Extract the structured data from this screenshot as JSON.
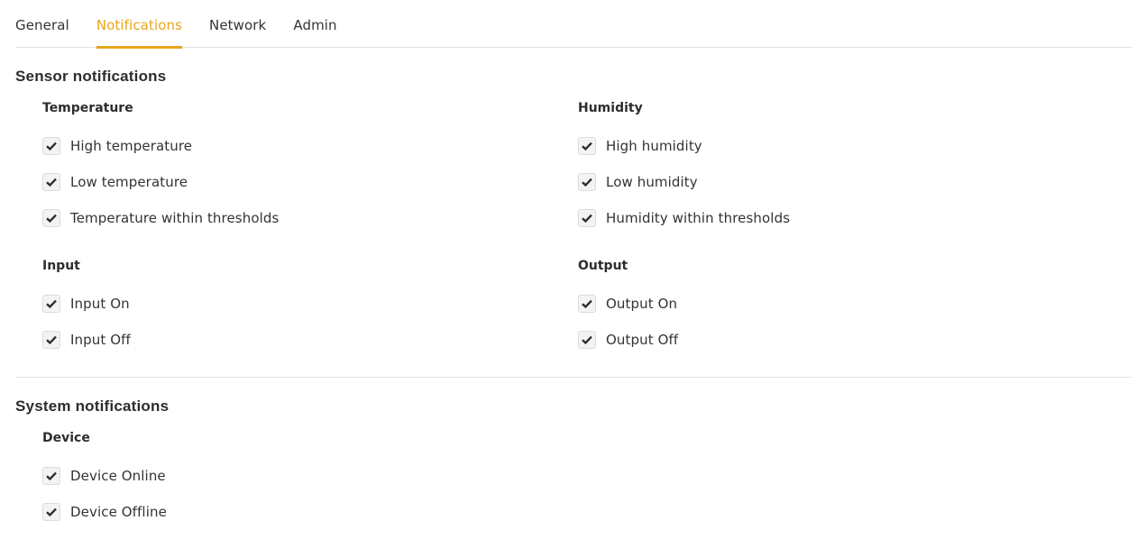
{
  "tabs": [
    {
      "label": "General",
      "active": false
    },
    {
      "label": "Notifications",
      "active": true
    },
    {
      "label": "Network",
      "active": false
    },
    {
      "label": "Admin",
      "active": false
    }
  ],
  "colors": {
    "accent": "#e8a61c",
    "text": "#333333",
    "divider": "#e1e1e1"
  },
  "sensor": {
    "title": "Sensor notifications",
    "temperature": {
      "title": "Temperature",
      "items": [
        {
          "label": "High temperature",
          "checked": true
        },
        {
          "label": "Low temperature",
          "checked": true
        },
        {
          "label": "Temperature within thresholds",
          "checked": true
        }
      ]
    },
    "humidity": {
      "title": "Humidity",
      "items": [
        {
          "label": "High humidity",
          "checked": true
        },
        {
          "label": "Low humidity",
          "checked": true
        },
        {
          "label": "Humidity within thresholds",
          "checked": true
        }
      ]
    },
    "input": {
      "title": "Input",
      "items": [
        {
          "label": "Input On",
          "checked": true
        },
        {
          "label": "Input Off",
          "checked": true
        }
      ]
    },
    "output": {
      "title": "Output",
      "items": [
        {
          "label": "Output On",
          "checked": true
        },
        {
          "label": "Output Off",
          "checked": true
        }
      ]
    }
  },
  "system": {
    "title": "System notifications",
    "device": {
      "title": "Device",
      "items": [
        {
          "label": "Device Online",
          "checked": true
        },
        {
          "label": "Device Offline",
          "checked": true
        }
      ]
    }
  }
}
